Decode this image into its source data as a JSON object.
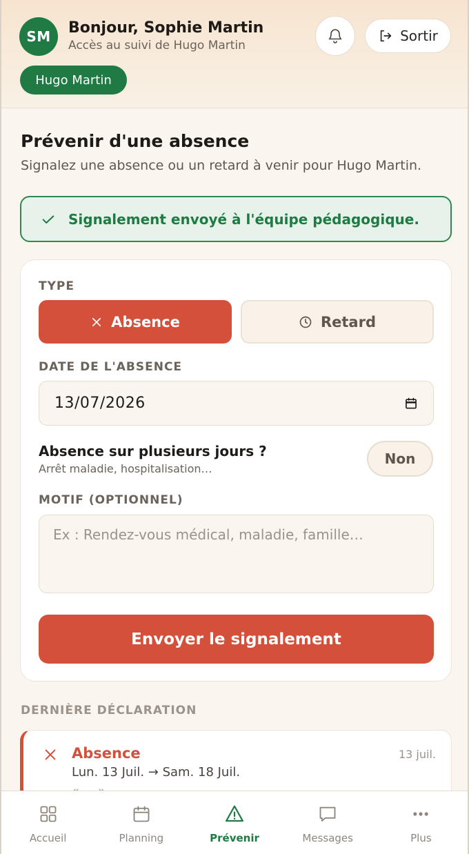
{
  "header": {
    "avatar_initials": "SM",
    "greeting": "Bonjour, Sophie Martin",
    "subgreeting": "Accès au suivi de Hugo Martin",
    "logout_label": "Sortir",
    "child_chip": "Hugo Martin",
    "icons": {
      "bell": "bell-icon",
      "logout": "logout-icon"
    }
  },
  "page": {
    "title": "Prévenir d'une absence",
    "subtitle": "Signalez une absence ou un retard à venir pour Hugo Martin."
  },
  "success_banner": {
    "text": "Signalement envoyé à l'équipe pédagogique.",
    "icon": "check-icon"
  },
  "form": {
    "type_label": "TYPE",
    "type_options": [
      {
        "label": "Absence",
        "icon": "x-icon",
        "selected": true
      },
      {
        "label": "Retard",
        "icon": "clock-icon",
        "selected": false
      }
    ],
    "date_label": "DATE DE L'ABSENCE",
    "date_value": "13/07/2026",
    "multi_day_title": "Absence sur plusieurs jours ?",
    "multi_day_sub": "Arrêt maladie, hospitalisation…",
    "multi_day_toggle": "Non",
    "motif_label": "MOTIF (OPTIONNEL)",
    "motif_placeholder": "Ex : Rendez-vous médical, maladie, famille…",
    "submit_label": "Envoyer le signalement"
  },
  "last_declaration": {
    "section_label": "DERNIÈRE DÉCLARATION",
    "type": "Absence",
    "date_short": "13 juil.",
    "range": "Lun. 13 Juil. → Sam. 18 Juil.",
    "note": "« ... »"
  },
  "bottom_nav": {
    "items": [
      {
        "label": "Accueil",
        "icon": "grid-icon",
        "active": false
      },
      {
        "label": "Planning",
        "icon": "calendar-icon",
        "active": false
      },
      {
        "label": "Prévenir",
        "icon": "warning-icon",
        "active": true
      },
      {
        "label": "Messages",
        "icon": "message-icon",
        "active": false
      },
      {
        "label": "Plus",
        "icon": "more-icon",
        "active": false
      }
    ]
  },
  "colors": {
    "brand_green": "#1f7a43",
    "accent_red": "#d4503b",
    "background": "#faf6ef"
  }
}
